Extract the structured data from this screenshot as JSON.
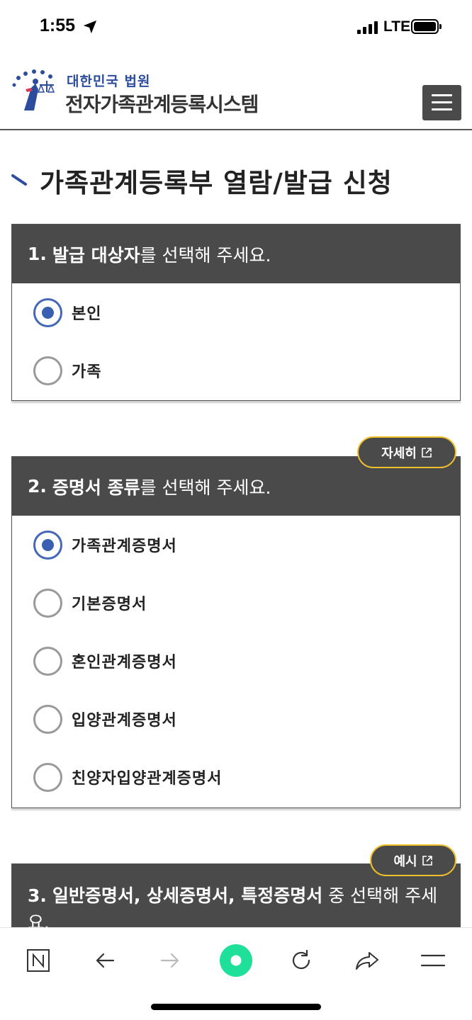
{
  "status_bar": {
    "time": "1:55",
    "network": "LTE"
  },
  "header": {
    "logo_sub": "대한민국 법원",
    "logo_main": "전자가족관계등록시스템"
  },
  "page_title": "가족관계등록부 열람/발급 신청",
  "section1": {
    "number": "1.",
    "bold": "발급 대상자",
    "rest": "를 선택해 주세요.",
    "options": [
      {
        "label": "본인",
        "checked": true
      },
      {
        "label": "가족",
        "checked": false
      }
    ]
  },
  "section2": {
    "number": "2.",
    "bold": "증명서 종류",
    "rest": "를 선택해 주세요.",
    "detail_button": "자세히",
    "options": [
      {
        "label": "가족관계증명서",
        "checked": true
      },
      {
        "label": "기본증명서",
        "checked": false
      },
      {
        "label": "혼인관계증명서",
        "checked": false
      },
      {
        "label": "입양관계증명서",
        "checked": false
      },
      {
        "label": "친양자입양관계증명서",
        "checked": false
      }
    ]
  },
  "section3": {
    "number": "3.",
    "bold": "일반증명서, 상세증명서, 특정증명서",
    "rest": " 중 선택해 주세요.",
    "example_button": "예시"
  },
  "colors": {
    "header_bg": "#4a4a4a",
    "radio_checked": "#3a5fb2",
    "pill_border": "#f0c12a",
    "brand_blue": "#2c4d9e",
    "naver_green": "#1ee09a"
  },
  "toolbar_icons": [
    "naver-n-icon",
    "back-arrow-icon",
    "forward-arrow-icon",
    "green-dot-icon",
    "refresh-icon",
    "share-icon",
    "menu-icon"
  ]
}
